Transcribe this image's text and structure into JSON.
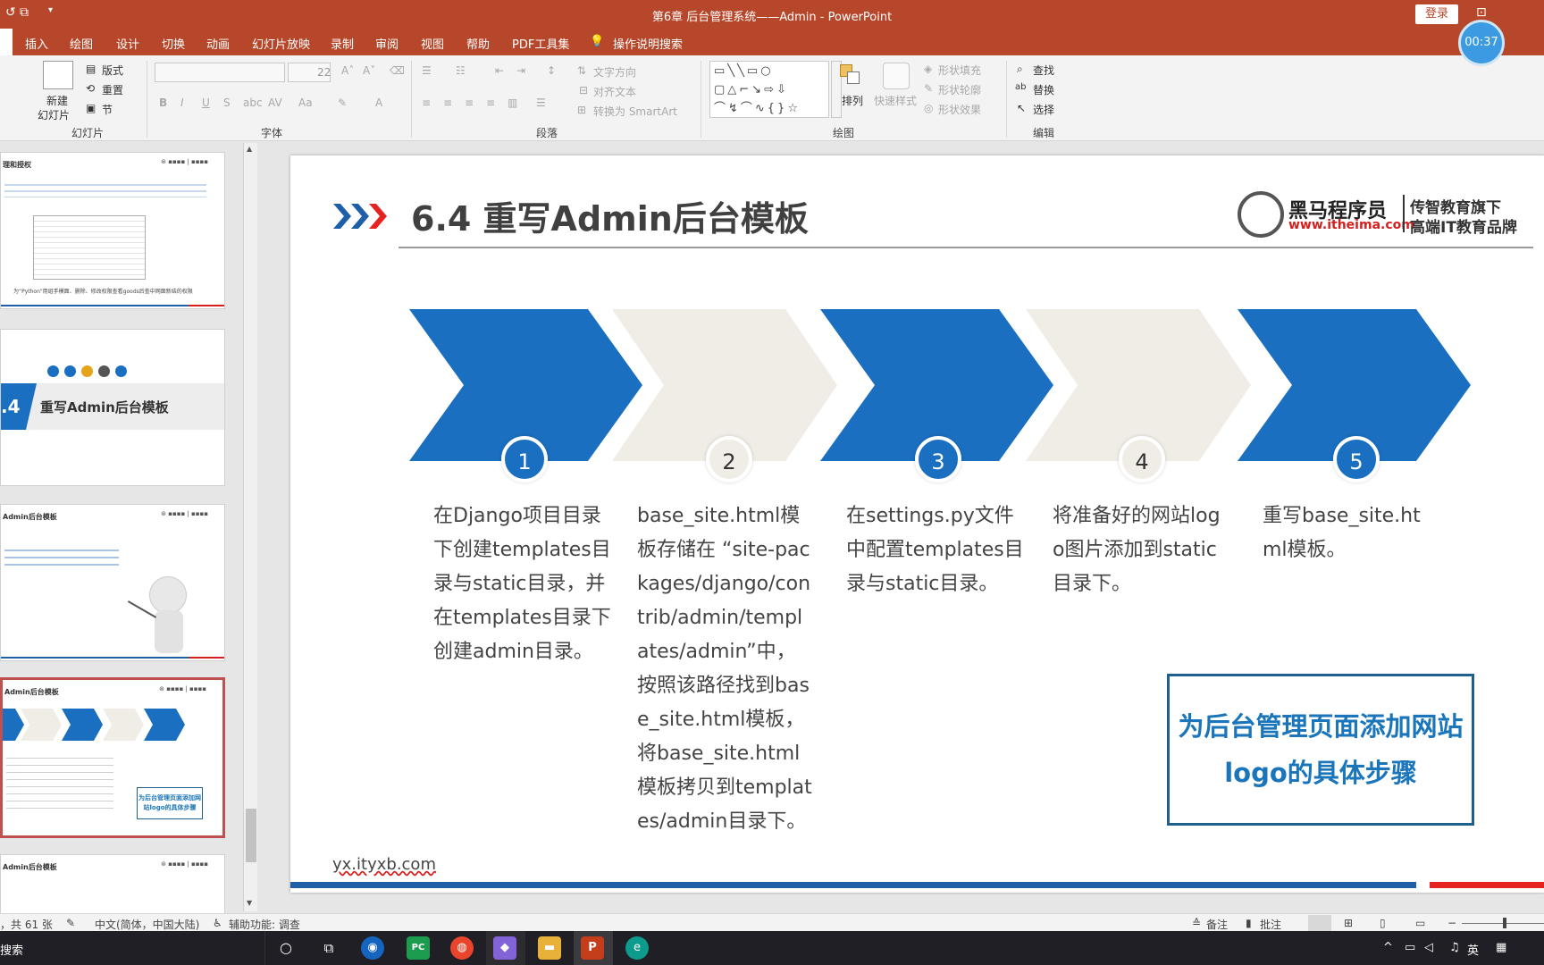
{
  "window": {
    "title": "第6章 后台管理系统——Admin  -  PowerPoint",
    "login_label": "登录",
    "timer": "00:37"
  },
  "menu": {
    "items": [
      "插入",
      "绘图",
      "设计",
      "切换",
      "动画",
      "幻灯片放映",
      "录制",
      "审阅",
      "视图",
      "帮助",
      "PDF工具集"
    ],
    "search": "操作说明搜索"
  },
  "ribbon": {
    "slides_group": "幻灯片",
    "new_slide": "新建",
    "new_slide2": "幻灯片",
    "layout": "版式",
    "reset": "重置",
    "section": "节",
    "font_group": "字体",
    "font_size": "22",
    "paragraph_group": "段落",
    "text_direction": "文字方向",
    "align_text": "对齐文本",
    "smartart": "转换为 SmartArt",
    "drawing_group": "绘图",
    "arrange": "排列",
    "quick_styles": "快速样式",
    "shape_fill": "形状填充",
    "shape_outline": "形状轮廓",
    "shape_effects": "形状效果",
    "edit_group": "编辑",
    "find": "查找",
    "replace": "替换",
    "select": "选择"
  },
  "thumbnails": [
    {
      "title": "理和授权",
      "caption": "为“Python”用组手模面、删除、修改权限查看goods后查中网面新结的权限"
    },
    {
      "badge": ".4",
      "title": "重写Admin后台模板"
    },
    {
      "title": "Admin后台模板"
    },
    {
      "title": "Admin后台模板",
      "callout": "为后台管理页面添加网站logo的具体步骤"
    },
    {
      "title": "Admin后台模板"
    }
  ],
  "slide": {
    "title": "6.4  重写Admin后台模板",
    "brand_cn": "黑马程序员",
    "brand_url": "www.itheima.com",
    "brand_tag1": "传智教育旗下",
    "brand_tag2": "高端IT教育品牌",
    "steps": [
      {
        "num": "1",
        "text": "在Django项目目录下创建templates目录与static目录，并在templates目录下创建admin目录。"
      },
      {
        "num": "2",
        "text": "base_site.html模板存储在 “site-packages/django/contrib/admin/templates/admin”中，按照该路径找到base_site.html模板，将base_site.html模板拷贝到templates/admin目录下。"
      },
      {
        "num": "3",
        "text": "在settings.py文件中配置templates目录与static目录。"
      },
      {
        "num": "4",
        "text": "将准备好的网站logo图片添加到static目录下。"
      },
      {
        "num": "5",
        "text": "重写base_site.html模板。"
      }
    ],
    "callout": "为后台管理页面添加网站logo的具体步骤",
    "footer_url": "yx.ityxb.com",
    "colors": {
      "blue": "#1a6fc0",
      "beige": "#efede6",
      "red": "#e52421"
    }
  },
  "status": {
    "slide_count": "，共 61 张",
    "language": "中文(简体，中国大陆)",
    "accessibility": "辅助功能: 调查",
    "notes": "备注",
    "comments": "批注"
  },
  "taskbar": {
    "search": "搜索",
    "ime": "英"
  }
}
